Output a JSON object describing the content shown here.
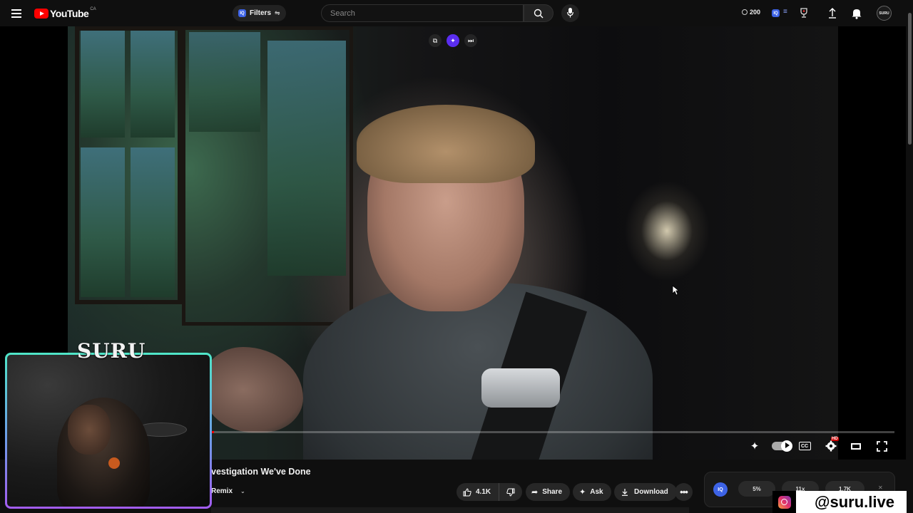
{
  "header": {
    "logo_text": "YouTube",
    "region": "CA",
    "filters_label": "Filters",
    "search_placeholder": "Search",
    "points": "200",
    "avatar_text": "SURU",
    "iq_badge": "IQ"
  },
  "player": {
    "progress": 0.004
  },
  "video": {
    "title": "vestigation We've Done",
    "remix_label": "Remix",
    "likes": "4.1K",
    "share_label": "Share",
    "ask_label": "Ask",
    "download_label": "Download"
  },
  "iq_panel": {
    "badge": "IQ",
    "stats": [
      "5%",
      "11x",
      "1.7K"
    ]
  },
  "overlay": {
    "cam_label": "SURU",
    "instagram_handle": "@suru.live"
  },
  "colors": {
    "brand_red": "#ff0000",
    "iq_blue": "#3d63e6",
    "accent_purple": "#5a2df0"
  }
}
